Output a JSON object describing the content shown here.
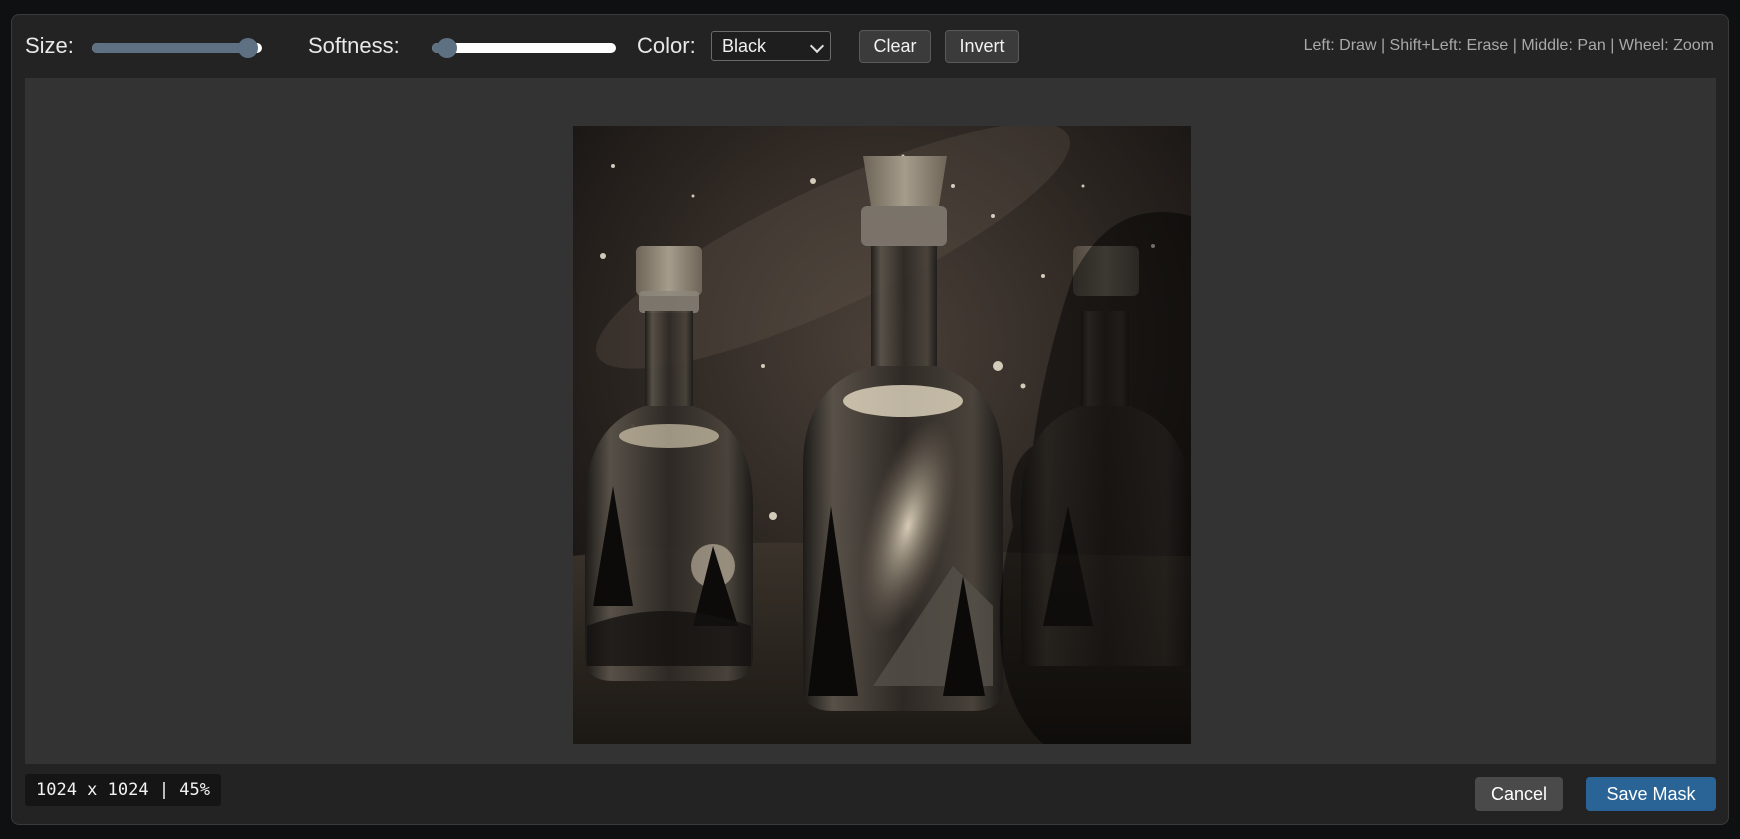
{
  "toolbar": {
    "size_label": "Size:",
    "size_value": 0.92,
    "softness_label": "Softness:",
    "softness_value": 0.08,
    "color_label": "Color:",
    "color_selected": "Black",
    "clear_label": "Clear",
    "invert_label": "Invert",
    "hint": "Left: Draw | Shift+Left: Erase | Middle: Pan | Wheel: Zoom"
  },
  "status": {
    "text": "1024 x 1024 | 45%"
  },
  "footer": {
    "cancel_label": "Cancel",
    "save_label": "Save Mask"
  },
  "colors": {
    "accent": "#2a6496",
    "slider_fill": "#5d7183",
    "panel": "#232323",
    "canvas_bg": "#333333"
  }
}
